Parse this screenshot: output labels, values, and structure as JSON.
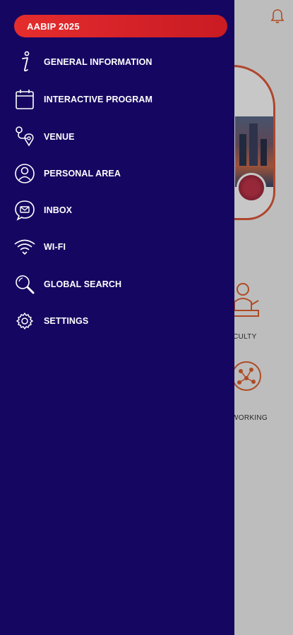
{
  "drawer": {
    "header_title": "AABIP 2025",
    "items": [
      {
        "label": "GENERAL INFORMATION",
        "icon": "info-icon"
      },
      {
        "label": "INTERACTIVE PROGRAM",
        "icon": "calendar-icon"
      },
      {
        "label": "VENUE",
        "icon": "location-route-icon"
      },
      {
        "label": "PERSONAL AREA",
        "icon": "user-icon"
      },
      {
        "label": "INBOX",
        "icon": "chat-mail-icon"
      },
      {
        "label": "WI-FI",
        "icon": "wifi-icon"
      },
      {
        "label": "GLOBAL SEARCH",
        "icon": "search-icon"
      },
      {
        "label": "SETTINGS",
        "icon": "gear-icon"
      }
    ]
  },
  "background": {
    "tile_label_1": "CULTY",
    "tile_label_2": "WORKING"
  },
  "colors": {
    "drawer_bg": "#150761",
    "pill_red": "#d32128",
    "accent_orange": "#e0622f"
  }
}
